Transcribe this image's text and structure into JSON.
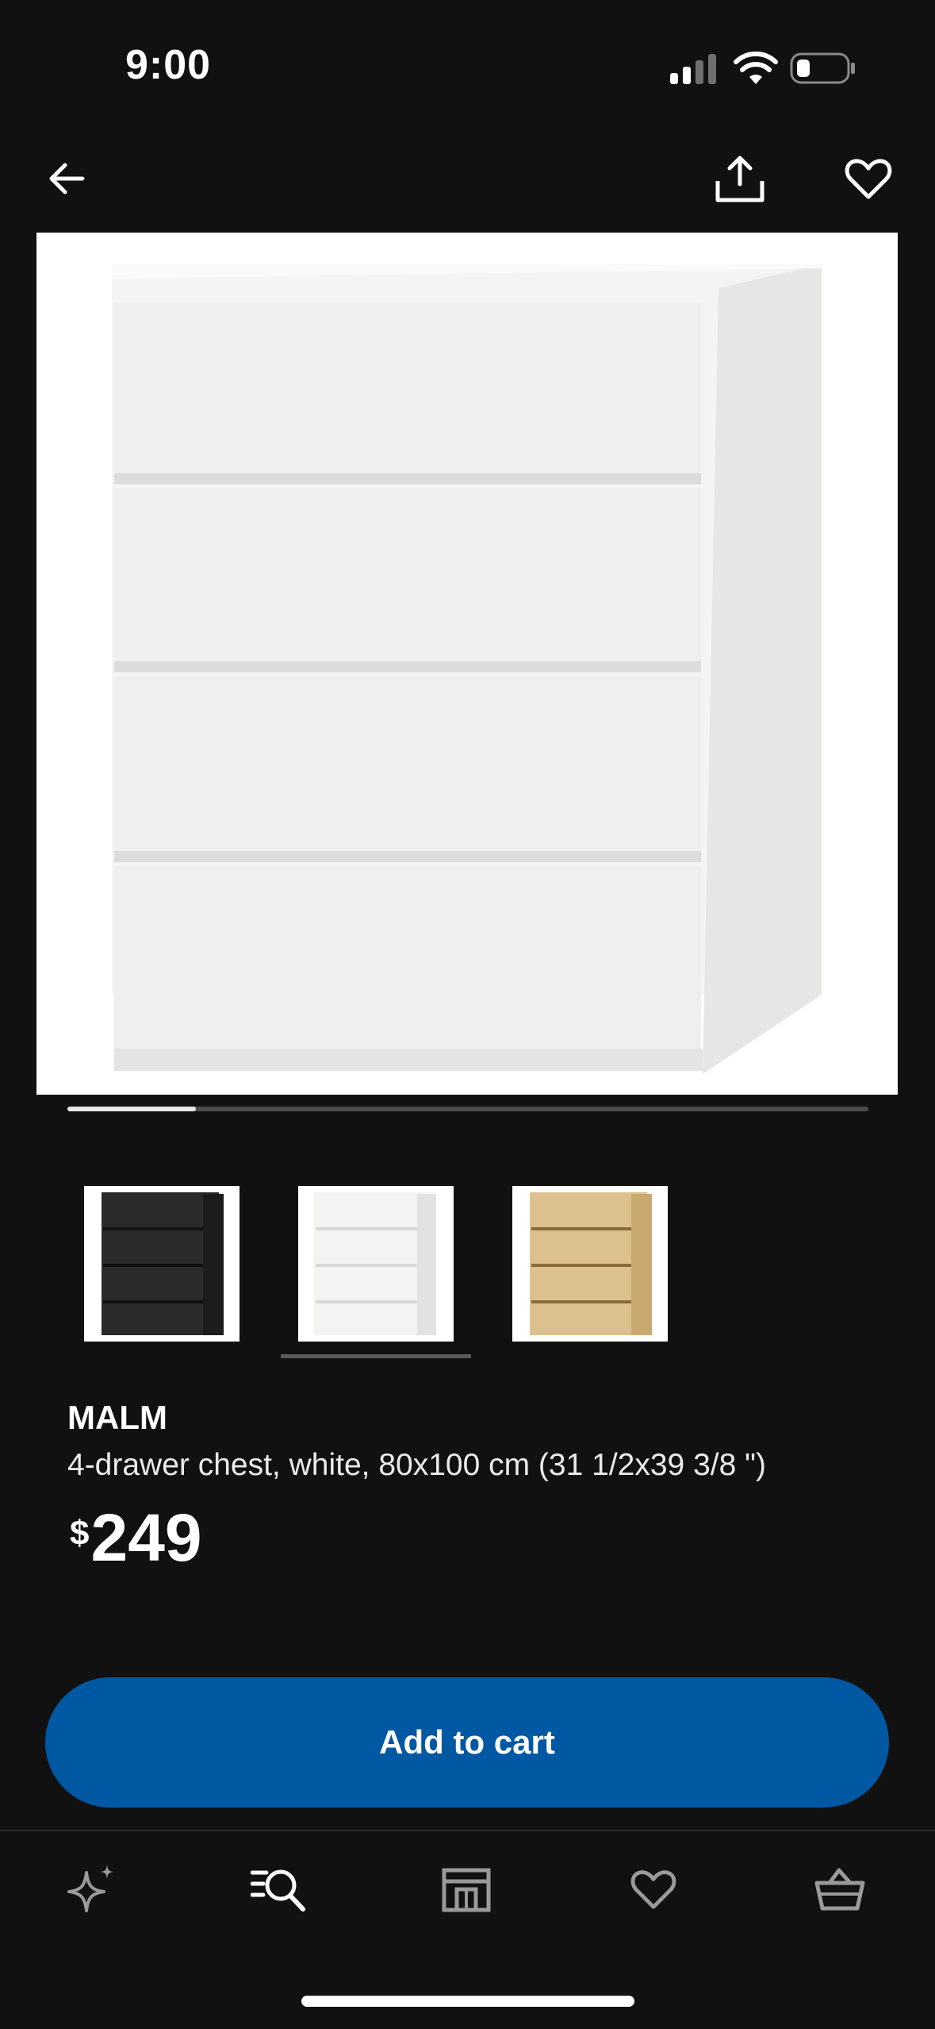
{
  "status_bar": {
    "time": "9:00"
  },
  "header": {
    "back_icon": "arrow-left-icon",
    "share_icon": "share-icon",
    "favorite_icon": "heart-icon"
  },
  "gallery": {
    "progress": 0.16
  },
  "swatches": [
    {
      "name": "black-brown",
      "color": "#2a2a2a"
    },
    {
      "name": "white",
      "color": "#f2f2f2",
      "selected": true
    },
    {
      "name": "white stained oak veneer",
      "color": "#dcc08e"
    }
  ],
  "product": {
    "name": "MALM",
    "description": "4-drawer chest, white, 80x100 cm (31 1/2x39 3/8 \")",
    "currency": "$",
    "price": "249"
  },
  "cart_button": {
    "label": "Add to cart",
    "color": "#0058a3"
  },
  "bottom_nav": [
    {
      "icon": "sparkle-icon"
    },
    {
      "icon": "search-list-icon",
      "active": true
    },
    {
      "icon": "store-icon"
    },
    {
      "icon": "heart-icon"
    },
    {
      "icon": "basket-icon"
    }
  ]
}
